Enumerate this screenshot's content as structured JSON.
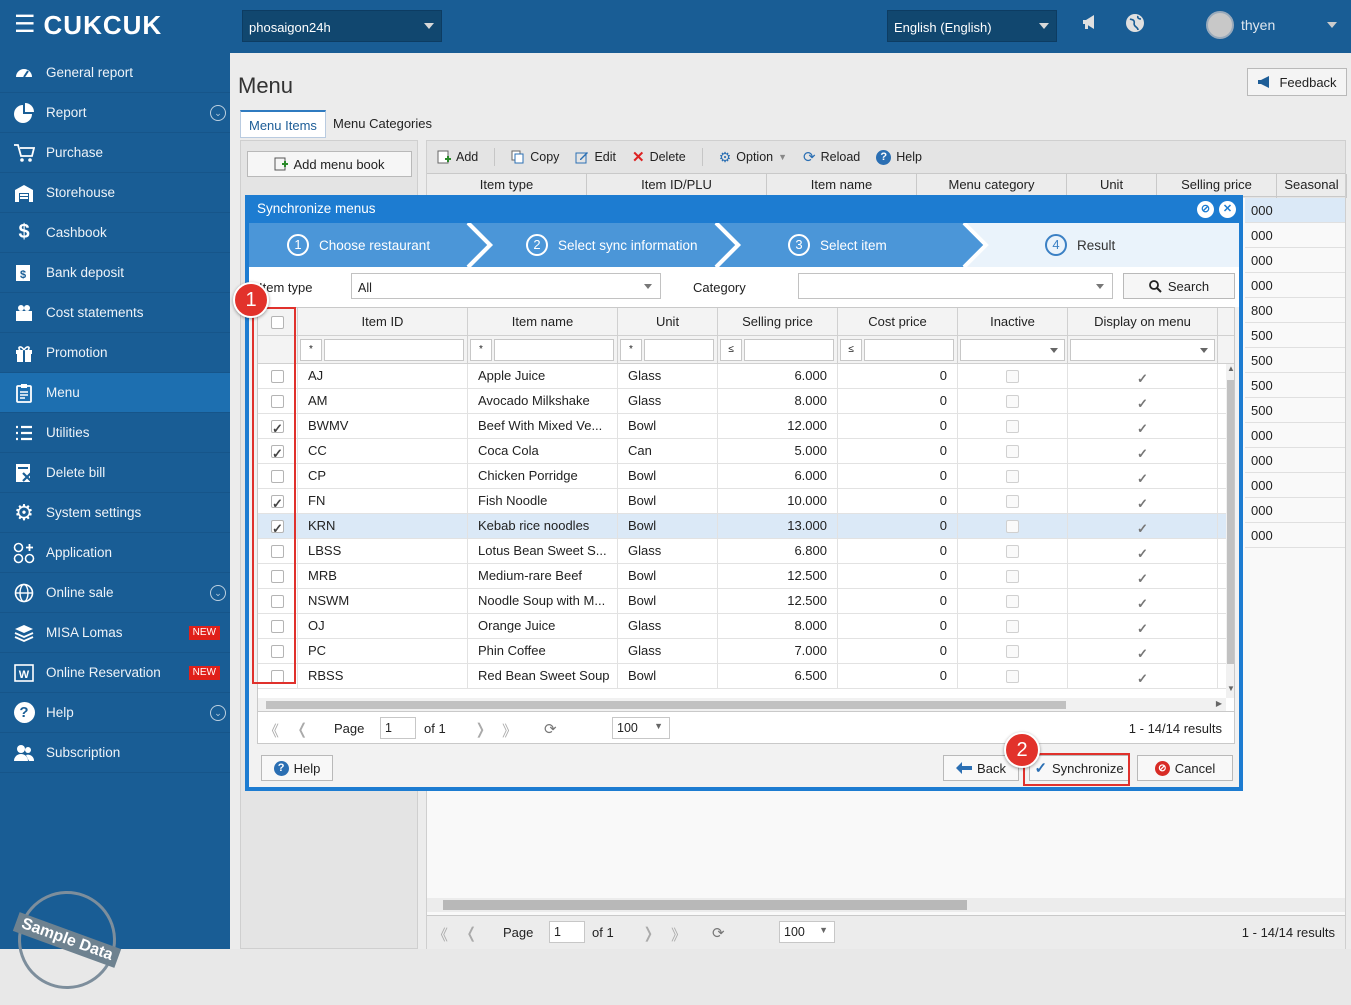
{
  "topbar": {
    "logo": "CUKCUK",
    "restaurant": "phosaigon24h",
    "language": "English (English)",
    "user": "thyen"
  },
  "sidebar": {
    "items": [
      {
        "label": "General report",
        "icon": "dashboard-icon"
      },
      {
        "label": "Report",
        "icon": "pie-chart-icon",
        "expand": true
      },
      {
        "label": "Purchase",
        "icon": "cart-icon"
      },
      {
        "label": "Storehouse",
        "icon": "warehouse-icon"
      },
      {
        "label": "Cashbook",
        "icon": "dollar-icon"
      },
      {
        "label": "Bank deposit",
        "icon": "bank-icon"
      },
      {
        "label": "Cost statements",
        "icon": "cost-icon"
      },
      {
        "label": "Promotion",
        "icon": "gift-icon"
      },
      {
        "label": "Menu",
        "icon": "menu-clipboard-icon",
        "active": true
      },
      {
        "label": "Utilities",
        "icon": "list-icon"
      },
      {
        "label": "Delete bill",
        "icon": "delete-bill-icon"
      },
      {
        "label": "System settings",
        "icon": "gear-icon"
      },
      {
        "label": "Application",
        "icon": "apps-icon"
      },
      {
        "label": "Online sale",
        "icon": "globe-icon",
        "expand": true
      },
      {
        "label": "MISA Lomas",
        "icon": "layers-icon",
        "badge": "NEW"
      },
      {
        "label": "Online Reservation",
        "icon": "reservation-icon",
        "badge": "NEW"
      },
      {
        "label": "Help",
        "icon": "question-icon",
        "expand": true
      },
      {
        "label": "Subscription",
        "icon": "users-icon"
      }
    ],
    "stamp": "Sample Data"
  },
  "page": {
    "title": "Menu",
    "feedback": "Feedback",
    "tabs": [
      "Menu Items",
      "Menu Categories"
    ],
    "add_menu_book": "Add menu book",
    "toolbar": {
      "add": "Add",
      "copy": "Copy",
      "edit": "Edit",
      "delete": "Delete",
      "option": "Option",
      "reload": "Reload",
      "help": "Help"
    },
    "columns": [
      "Item type",
      "Item ID/PLU",
      "Item name",
      "Menu category",
      "Unit",
      "Selling price",
      "Seasonal"
    ],
    "bg_prices": [
      "000",
      "000",
      "000",
      "000",
      "800",
      "500",
      "500",
      "500",
      "500",
      "000",
      "000",
      "000",
      "000",
      "000"
    ],
    "pager": {
      "page_label": "Page",
      "page": "1",
      "of": "of 1",
      "size": "100",
      "results": "1 - 14/14 results"
    }
  },
  "dialog": {
    "title": "Synchronize menus",
    "steps": [
      {
        "num": "1",
        "label": "Choose restaurant"
      },
      {
        "num": "2",
        "label": "Select sync information"
      },
      {
        "num": "3",
        "label": "Select item"
      },
      {
        "num": "4",
        "label": "Result"
      }
    ],
    "filter": {
      "item_type_label": "Item type",
      "item_type_value": "All",
      "category_label": "Category",
      "category_value": "",
      "search": "Search"
    },
    "columns": [
      "Item ID",
      "Item name",
      "Unit",
      "Selling price",
      "Cost price",
      "Inactive",
      "Display on menu"
    ],
    "filter_ops": {
      "item_id": "*",
      "item_name": "*",
      "unit": "*",
      "selling_price": "≤",
      "cost_price": "≤"
    },
    "rows": [
      {
        "checked": false,
        "id": "AJ",
        "name": "Apple Juice",
        "unit": "Glass",
        "price": "6.000",
        "cost": "0",
        "inactive": false,
        "display": true
      },
      {
        "checked": false,
        "id": "AM",
        "name": "Avocado Milkshake",
        "unit": "Glass",
        "price": "8.000",
        "cost": "0",
        "inactive": false,
        "display": true
      },
      {
        "checked": true,
        "id": "BWMV",
        "name": "Beef With Mixed Ve...",
        "unit": "Bowl",
        "price": "12.000",
        "cost": "0",
        "inactive": false,
        "display": true
      },
      {
        "checked": true,
        "id": "CC",
        "name": "Coca Cola",
        "unit": "Can",
        "price": "5.000",
        "cost": "0",
        "inactive": false,
        "display": true
      },
      {
        "checked": false,
        "id": "CP",
        "name": "Chicken Porridge",
        "unit": "Bowl",
        "price": "6.000",
        "cost": "0",
        "inactive": false,
        "display": true
      },
      {
        "checked": true,
        "id": "FN",
        "name": "Fish Noodle",
        "unit": "Bowl",
        "price": "10.000",
        "cost": "0",
        "inactive": false,
        "display": true
      },
      {
        "checked": true,
        "id": "KRN",
        "name": "Kebab rice noodles",
        "unit": "Bowl",
        "price": "13.000",
        "cost": "0",
        "inactive": false,
        "display": true,
        "selected": true
      },
      {
        "checked": false,
        "id": "LBSS",
        "name": "Lotus Bean Sweet S...",
        "unit": "Glass",
        "price": "6.800",
        "cost": "0",
        "inactive": false,
        "display": true
      },
      {
        "checked": false,
        "id": "MRB",
        "name": "Medium-rare Beef",
        "unit": "Bowl",
        "price": "12.500",
        "cost": "0",
        "inactive": false,
        "display": true
      },
      {
        "checked": false,
        "id": "NSWM",
        "name": "Noodle Soup with M...",
        "unit": "Bowl",
        "price": "12.500",
        "cost": "0",
        "inactive": false,
        "display": true
      },
      {
        "checked": false,
        "id": "OJ",
        "name": "Orange Juice",
        "unit": "Glass",
        "price": "8.000",
        "cost": "0",
        "inactive": false,
        "display": true
      },
      {
        "checked": false,
        "id": "PC",
        "name": "Phin Coffee",
        "unit": "Glass",
        "price": "7.000",
        "cost": "0",
        "inactive": false,
        "display": true
      },
      {
        "checked": false,
        "id": "RBSS",
        "name": "Red Bean Sweet Soup",
        "unit": "Bowl",
        "price": "6.500",
        "cost": "0",
        "inactive": false,
        "display": true
      }
    ],
    "pager": {
      "page_label": "Page",
      "page": "1",
      "of": "of 1",
      "size": "100",
      "results": "1 - 14/14 results"
    },
    "buttons": {
      "help": "Help",
      "back": "Back",
      "synchronize": "Synchronize",
      "cancel": "Cancel"
    },
    "annotations": [
      "1",
      "2"
    ]
  },
  "colors": {
    "sidebar": "#195d95",
    "accent": "#1d7cd1",
    "highlight": "#e0312c"
  }
}
